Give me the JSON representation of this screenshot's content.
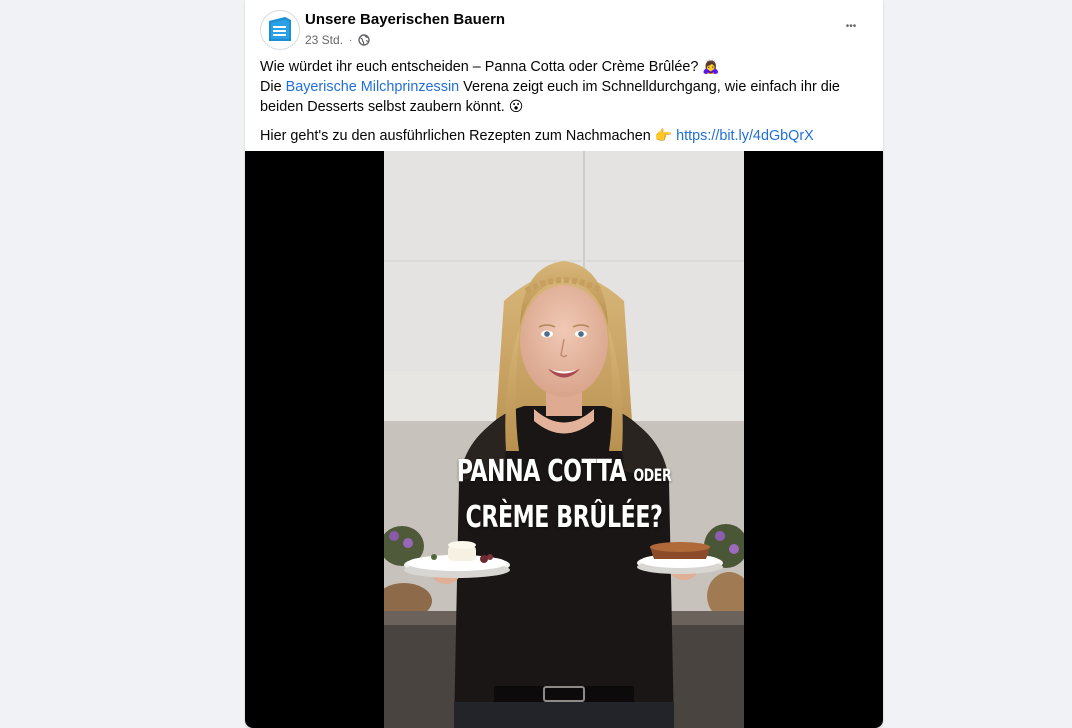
{
  "post": {
    "author": "Unsere Bayerischen Bauern",
    "time": "23 Std.",
    "separator": "·",
    "privacy_icon": "globe-icon",
    "more_icon": "more-dots-icon",
    "more_label": "•••",
    "text": {
      "line1": "Wie würdet ihr euch entscheiden – Panna Cotta oder Crème Brûlée?",
      "line1_emoji": "🙇‍♀️",
      "line2_prefix": "Die ",
      "line2_link": "Bayerische Milchprinzessin",
      "line2_rest": " Verena zeigt euch im Schnelldurchgang, wie einfach ihr die beiden Desserts selbst zaubern könnt.",
      "line2_emoji": "😮",
      "line3_prefix": "Hier geht's zu den ausführlichen Rezepten zum Nachmachen",
      "line3_emoji": "👉",
      "line3_link": "https://bit.ly/4dGbQrX"
    }
  },
  "video": {
    "overlay_line1_main": "PANNA COTTA",
    "overlay_line1_small": "ODER",
    "overlay_line2": "CRÈME BRÛLÉE?"
  },
  "colors": {
    "link": "#216fdb",
    "page_bg": "#f0f2f5",
    "card_bg": "#ffffff",
    "brand_blue": "#1e8fd6"
  }
}
